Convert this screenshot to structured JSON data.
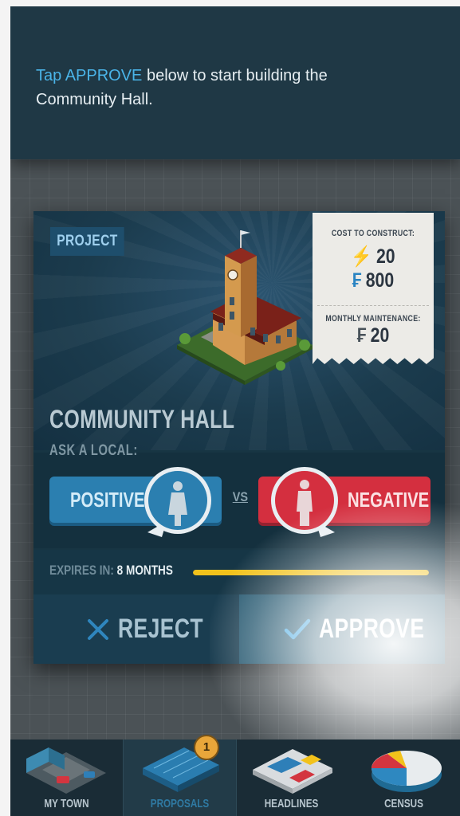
{
  "tip": {
    "highlight": "Tap APPROVE",
    "text": " below to start building the Community Hall."
  },
  "card": {
    "badge": "PROJECT",
    "title": "COMMUNITY HALL",
    "ask_label": "ASK A LOCAL:",
    "positive_label": "POSITIVE",
    "negative_label": "NEGATIVE",
    "vs_label": "VS",
    "cost": {
      "header": "COST TO CONSTRUCT:",
      "energy": "20",
      "money": "800",
      "maintenance_header": "MONTHLY MAINTENANCE:",
      "maintenance": "20"
    },
    "expires": {
      "label": "EXPIRES IN:",
      "value": "8 MONTHS",
      "progress": 1.0
    },
    "actions": {
      "reject_label": "REJECT",
      "approve_label": "APPROVE"
    }
  },
  "tabs": [
    {
      "label": "MY TOWN",
      "icon": "town-icon",
      "active": false
    },
    {
      "label": "PROPOSALS",
      "icon": "proposals-icon",
      "active": true,
      "badge": "1"
    },
    {
      "label": "HEADLINES",
      "icon": "newspaper-icon",
      "active": false
    },
    {
      "label": "CENSUS",
      "icon": "pie-chart-icon",
      "active": false
    }
  ],
  "colors": {
    "accent_blue": "#4ab4e8",
    "positive": "#2b7fb0",
    "negative": "#d42f3f",
    "progress": "#f2c21b"
  }
}
